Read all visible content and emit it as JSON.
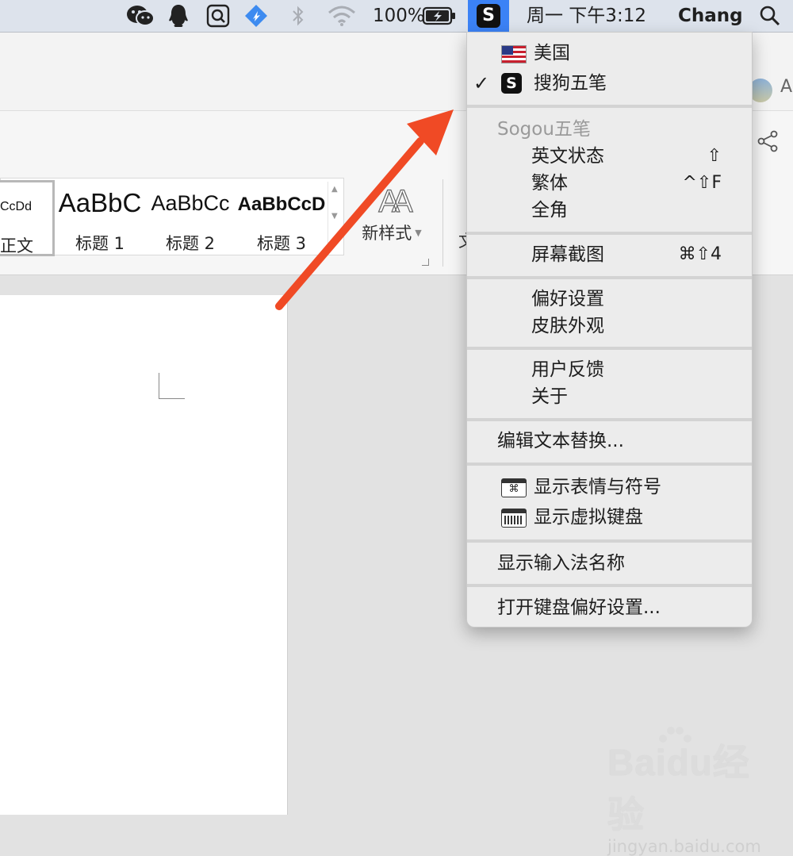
{
  "menubar": {
    "battery": "100%",
    "clock": "周一 下午3:12",
    "user": "Chang",
    "ime_logo": "S",
    "icons": [
      "wechat-icon",
      "qq-icon",
      "search-app-icon",
      "feishu-icon",
      "bluetooth-icon",
      "wifi-icon",
      "battery-icon",
      "spotlight-icon"
    ]
  },
  "window": {
    "avatar_letter": "A",
    "styles": [
      {
        "sample": "CcDd",
        "label": "正文"
      },
      {
        "sample": "AaBbC",
        "label": "标题 1"
      },
      {
        "sample": "AaBbCc",
        "label": "标题 2"
      },
      {
        "sample": "AaBbCcD",
        "label": "标题 3"
      }
    ],
    "new_style_icon": "AA",
    "new_style_label": "新样式",
    "partial_label": "文"
  },
  "ime_menu": {
    "input_sources": [
      {
        "label": "美国",
        "checked": false,
        "icon": "us-flag-icon"
      },
      {
        "label": "搜狗五笔",
        "checked": true,
        "icon": "sogou-icon"
      }
    ],
    "section_header": "Sogou五笔",
    "options": [
      {
        "label": "英文状态",
        "shortcut": "⇧"
      },
      {
        "label": "繁体",
        "shortcut": "^⇧F"
      },
      {
        "label": "全角",
        "shortcut": ""
      }
    ],
    "screenshot": {
      "label": "屏幕截图",
      "shortcut": "⌘⇧4"
    },
    "prefs": [
      "偏好设置",
      "皮肤外观"
    ],
    "about": [
      "用户反馈",
      "关于"
    ],
    "edit_replace": "编辑文本替换...",
    "viewers": [
      {
        "label": "显示表情与符号",
        "icon": "emoji-viewer-icon"
      },
      {
        "label": "显示虚拟键盘",
        "icon": "keyboard-viewer-icon"
      }
    ],
    "show_name": "显示输入法名称",
    "open_prefs": "打开键盘偏好设置..."
  },
  "watermark": {
    "main": "Baidu经验",
    "sub": "jingyan.baidu.com"
  },
  "colors": {
    "accent": "#3b82f6",
    "arrow": "#f04a25"
  }
}
